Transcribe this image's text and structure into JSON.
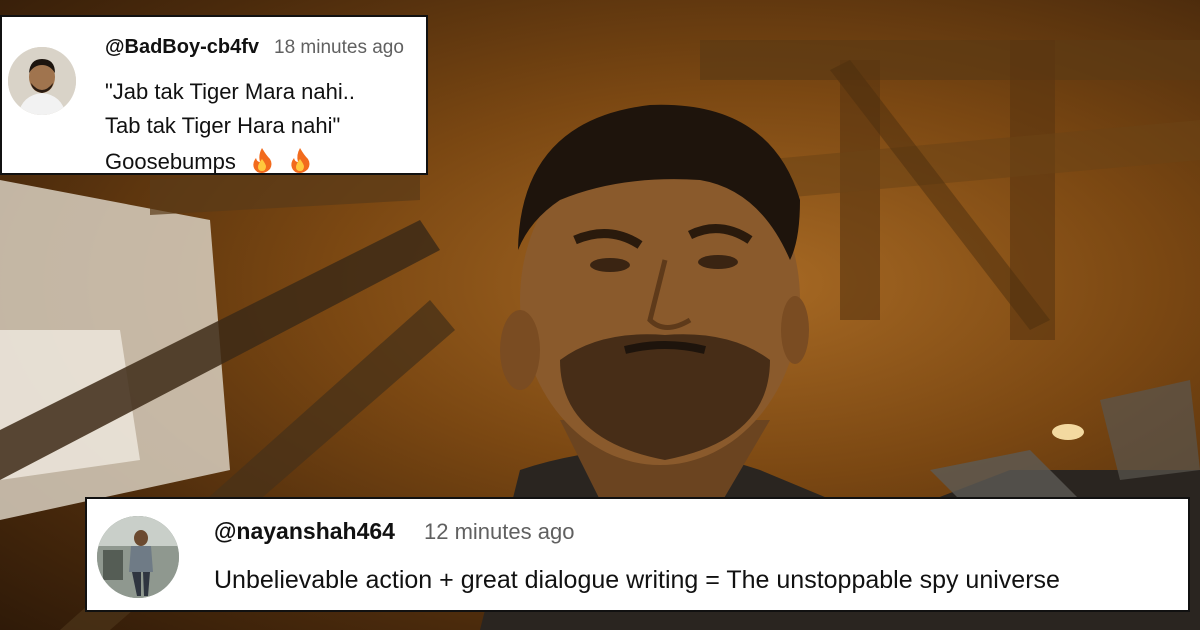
{
  "comments": [
    {
      "handle": "@BadBoy-cb4fv",
      "time": "18 minutes ago",
      "lines": [
        "\"Jab tak Tiger Mara nahi..",
        "Tab tak Tiger Hara nahi\"",
        "Goosebumps"
      ],
      "emoji_icons": [
        "fire-icon",
        "fire-icon"
      ]
    },
    {
      "handle": "@nayanshah464",
      "time": "12 minutes ago",
      "lines": [
        "Unbelievable action + great dialogue writing = The unstoppable spy universe"
      ]
    }
  ],
  "colors": {
    "card_bg": "#ffffff",
    "card_border": "#111111",
    "timestamp": "#606060",
    "flame": "#f26b1d"
  }
}
